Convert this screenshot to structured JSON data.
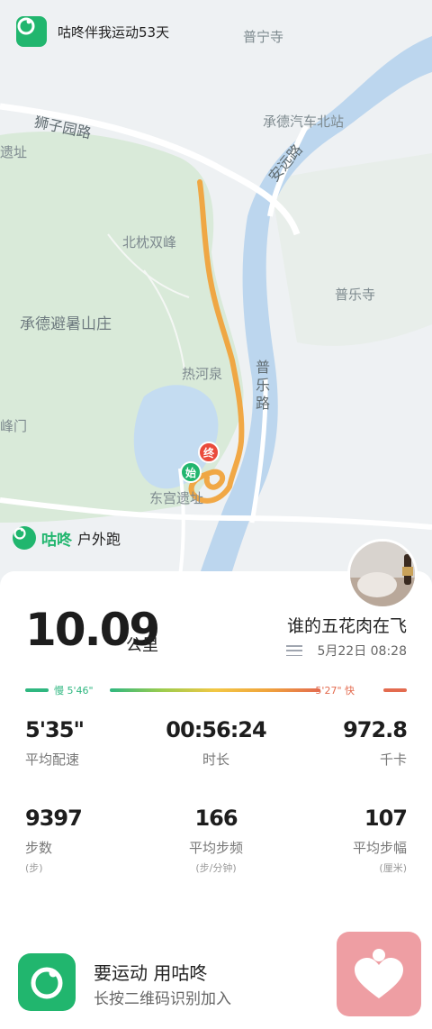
{
  "header": {
    "brand_text": "咕咚伴我运动53天"
  },
  "map": {
    "labels": {
      "puning_temple": "普宁寺",
      "shizi_road": "狮子园路",
      "chengde_north_station": "承德汽车北站",
      "anyuan_road": "安远路",
      "ruins": "遗址",
      "beizhen_peak": "北枕双峰",
      "pule_temple": "普乐寺",
      "mountain_resort": "承德避暑山庄",
      "rehe_spring": "热河泉",
      "pule_road": "普乐路",
      "feng_gate": "峰门",
      "donggong_ruins": "东宫遗址"
    },
    "markers": {
      "end": "终",
      "start": "始"
    }
  },
  "sport_tag": {
    "app_name": "咕咚",
    "type": "户外跑"
  },
  "summary": {
    "distance": "10.09",
    "distance_unit": "公里",
    "user_name": "谁的五花肉在飞",
    "date_time": "5月22日 08:28"
  },
  "pace_legend": {
    "slow_label": "慢 5'46\"",
    "fast_label": "5'27\" 快",
    "slow_color": "#2fb780",
    "fast_color": "#e36b4f"
  },
  "stats": [
    {
      "value": "5'35\"",
      "label": "平均配速",
      "unit": ""
    },
    {
      "value": "00:56:24",
      "label": "时长",
      "unit": ""
    },
    {
      "value": "972.8",
      "label": "千卡",
      "unit": ""
    },
    {
      "value": "9397",
      "label": "步数",
      "unit": "(步)"
    },
    {
      "value": "166",
      "label": "平均步频",
      "unit": "(步/分钟)"
    },
    {
      "value": "107",
      "label": "平均步幅",
      "unit": "(厘米)"
    }
  ],
  "promo": {
    "title": "要运动 用咕咚",
    "subtitle": "长按二维码识别加入"
  },
  "colors": {
    "brand_green": "#21b66e",
    "route_orange": "#f0a33c",
    "river_blue": "#bcd6ee"
  }
}
